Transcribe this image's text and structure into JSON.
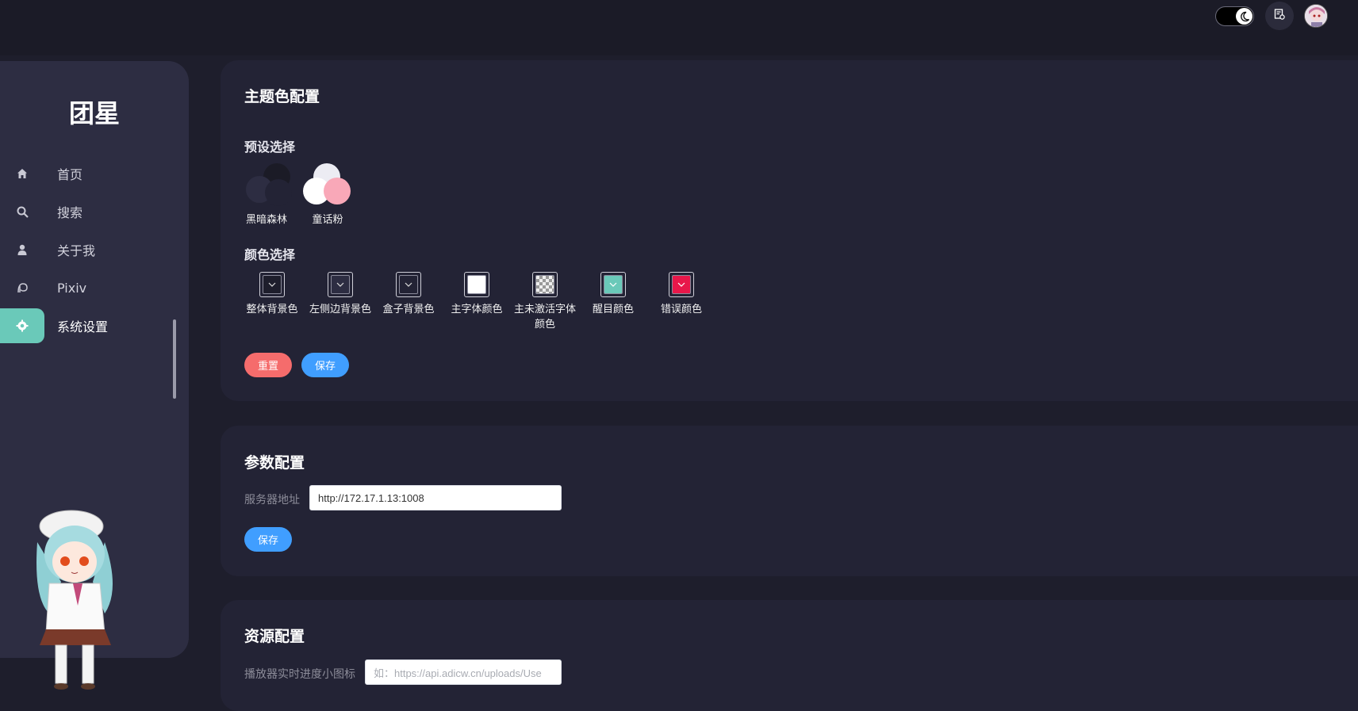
{
  "header": {
    "theme_toggle_icon": "moon-icon",
    "doc_button_icon": "document-icon",
    "avatar_icon": "user-avatar"
  },
  "sidebar": {
    "brand": "团星",
    "items": [
      {
        "label": "首页",
        "icon": "home-icon"
      },
      {
        "label": "搜索",
        "icon": "search-icon"
      },
      {
        "label": "关于我",
        "icon": "user-icon"
      },
      {
        "label": "Pixiv",
        "icon": "pixiv-icon"
      },
      {
        "label": "系统设置",
        "icon": "gear-icon",
        "active": true
      }
    ],
    "accent_color": "#6ac9b9"
  },
  "theme_panel": {
    "title": "主题色配置",
    "preset_heading": "预设选择",
    "presets": [
      {
        "label": "黑暗森林"
      },
      {
        "label": "童话粉"
      }
    ],
    "color_heading": "颜色选择",
    "colors": [
      {
        "label": "整体背景色",
        "color": "#1e1e2c"
      },
      {
        "label": "左侧边背景色",
        "color": "#2d2d42"
      },
      {
        "label": "盒子背景色",
        "color": "#232335"
      },
      {
        "label": "主字体颜色",
        "color": "#ffffff"
      },
      {
        "label": "主未激活字体颜色",
        "color": "checkered"
      },
      {
        "label": "醒目颜色",
        "color": "#6ac9b9"
      },
      {
        "label": "错误颜色",
        "color": "#e8174a"
      }
    ],
    "reset_label": "重置",
    "save_label": "保存"
  },
  "param_panel": {
    "title": "参数配置",
    "server_label": "服务器地址",
    "server_value": "http://172.17.1.13:1008",
    "save_label": "保存"
  },
  "resource_panel": {
    "title": "资源配置",
    "player_icon_label": "播放器实时进度小图标",
    "player_icon_placeholder": "如：https://api.adicw.cn/uploads/Use"
  }
}
